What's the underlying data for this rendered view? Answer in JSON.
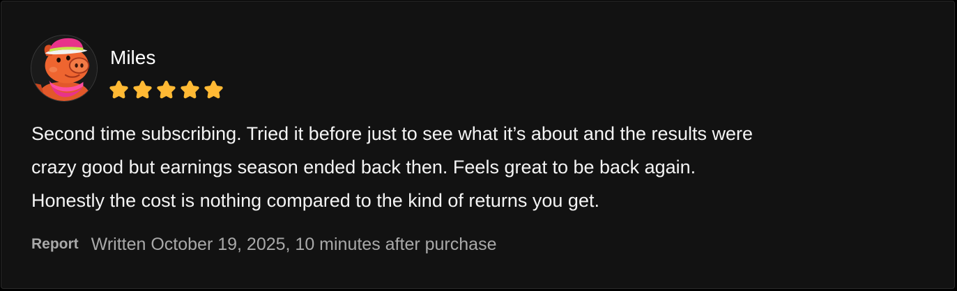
{
  "review": {
    "reviewer": {
      "name": "Miles",
      "avatar_icon": "pig-mascot-icon"
    },
    "rating": 5,
    "rating_max": 5,
    "star_color": "#FFB934",
    "body_lines": [
      "Second time subscribing. Tried it before just to see what it’s about and the results were",
      "crazy good but earnings season ended back then. Feels great to be back again.",
      "Honestly the cost is nothing compared to the kind of returns you get."
    ],
    "footer": {
      "report_label": "Report",
      "written_text": "Written October 19, 2025, 10 minutes after purchase"
    }
  }
}
